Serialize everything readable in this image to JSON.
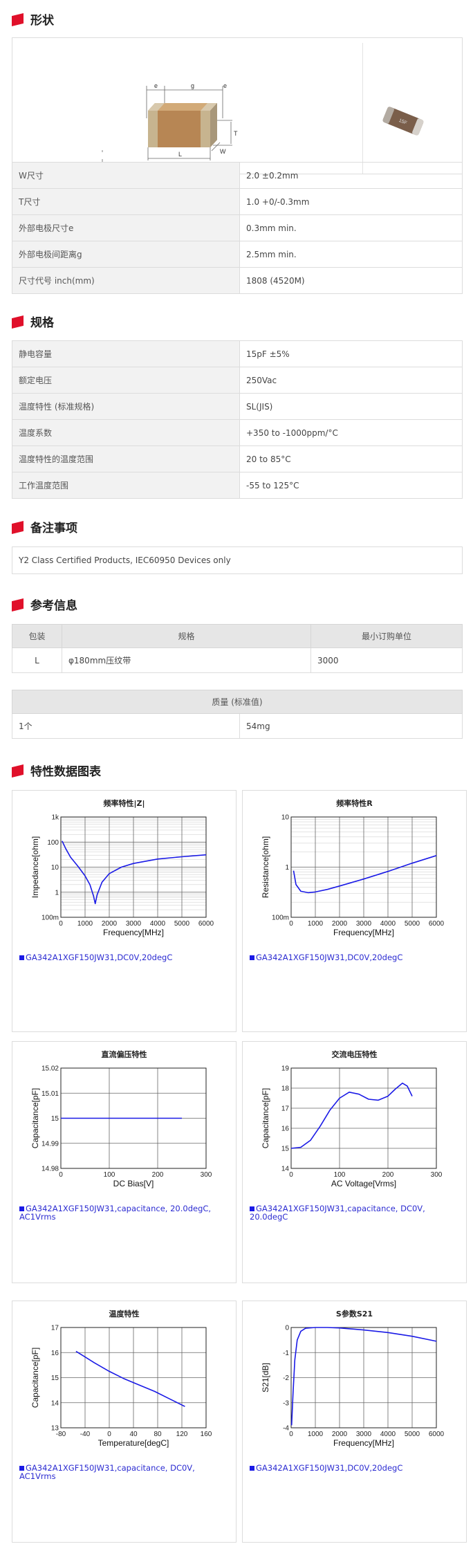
{
  "sections": {
    "shape": "形状",
    "spec": "规格",
    "notes": "备注事项",
    "ref": "参考信息",
    "charts": "特性数据图表"
  },
  "diagram": {
    "e1": "e",
    "g": "g",
    "e2": "e",
    "t": "T",
    "l": "L",
    "w": "W",
    "part_mark": "15F"
  },
  "shape_rows": [
    {
      "k": "W尺寸",
      "v": "2.0 ±0.2mm"
    },
    {
      "k": "T尺寸",
      "v": "1.0 +0/-0.3mm"
    },
    {
      "k": "外部电极尺寸e",
      "v": "0.3mm min."
    },
    {
      "k": "外部电极间距离g",
      "v": "2.5mm min."
    },
    {
      "k": "尺寸代号 inch(mm)",
      "v": "1808 (4520M)"
    }
  ],
  "spec_rows": [
    {
      "k": "静电容量",
      "v": "15pF ±5%"
    },
    {
      "k": "额定电压",
      "v": "250Vac"
    },
    {
      "k": "温度特性 (标准规格)",
      "v": "SL(JIS)"
    },
    {
      "k": "温度系数",
      "v": "+350 to -1000ppm/°C"
    },
    {
      "k": "温度特性的温度范围",
      "v": "20 to 85°C"
    },
    {
      "k": "工作温度范围",
      "v": "-55 to 125°C"
    }
  ],
  "notes_text": "Y2 Class Certified Products, IEC60950 Devices only",
  "ref_table": {
    "headers": [
      "包装",
      "规格",
      "最小订购单位"
    ],
    "row": [
      "L",
      "φ180mm压纹带",
      "3000"
    ]
  },
  "mass_table": {
    "header": "质量 (标准值)",
    "row": [
      "1个",
      "54mg"
    ]
  },
  "colors": {
    "accent": "#e0102a",
    "curve": "#1a1ae6",
    "legend": "#2b2bd1"
  },
  "chart_data": [
    {
      "type": "line",
      "title": "频率特性|Z|",
      "xlabel": "Frequency[MHz]",
      "ylabel": "Impedance[ohm]",
      "xlim": [
        0,
        6000
      ],
      "ylim": [
        0.1,
        1000
      ],
      "yscale": "log",
      "xticks": [
        "0",
        "1000",
        "2000",
        "3000",
        "4000",
        "5000",
        "6000"
      ],
      "yticks": [
        "100m",
        "1",
        "10",
        "100",
        "1k"
      ],
      "series": [
        {
          "name": "GA342A1XGF150JW31,DC0V,20degC",
          "x": [
            50,
            200,
            400,
            700,
            1000,
            1200,
            1350,
            1420,
            1500,
            1700,
            2000,
            2500,
            3000,
            4000,
            5000,
            6000
          ],
          "y": [
            110,
            55,
            25,
            11,
            4.5,
            2,
            0.7,
            0.35,
            0.8,
            2.5,
            5.5,
            10,
            14,
            21,
            26,
            31
          ]
        }
      ],
      "legend": "GA342A1XGF150JW31,DC0V,20degC"
    },
    {
      "type": "line",
      "title": "频率特性R",
      "xlabel": "Frequency[MHz]",
      "ylabel": "Resistance[ohm]",
      "xlim": [
        0,
        6000
      ],
      "ylim": [
        0.1,
        10
      ],
      "yscale": "log",
      "xticks": [
        "0",
        "1000",
        "2000",
        "3000",
        "4000",
        "5000",
        "6000"
      ],
      "yticks": [
        "100m",
        "1",
        "10"
      ],
      "series": [
        {
          "name": "GA342A1XGF150JW31,DC0V,20degC",
          "x": [
            100,
            200,
            400,
            700,
            1000,
            1500,
            2000,
            3000,
            4000,
            5000,
            6000
          ],
          "y": [
            0.85,
            0.45,
            0.33,
            0.31,
            0.32,
            0.36,
            0.42,
            0.58,
            0.82,
            1.2,
            1.7
          ]
        }
      ],
      "legend": "GA342A1XGF150JW31,DC0V,20degC"
    },
    {
      "type": "line",
      "title": "直流偏压特性",
      "xlabel": "DC Bias[V]",
      "ylabel": "Capacitance[pF]",
      "xlim": [
        0,
        300
      ],
      "ylim": [
        14.98,
        15.02
      ],
      "xticks": [
        "0",
        "100",
        "200",
        "300"
      ],
      "yticks": [
        "14.98",
        "14.99",
        "15",
        "15.01",
        "15.02"
      ],
      "series": [
        {
          "name": "GA342A1XGF150JW31,capacitance, 20.0degC, AC1Vrms",
          "x": [
            0,
            250
          ],
          "y": [
            15,
            15
          ]
        }
      ],
      "legend": "GA342A1XGF150JW31,capacitance, 20.0degC, AC1Vrms"
    },
    {
      "type": "line",
      "title": "交流电压特性",
      "xlabel": "AC Voltage[Vrms]",
      "ylabel": "Capacitance[pF]",
      "xlim": [
        0,
        300
      ],
      "ylim": [
        14,
        19
      ],
      "xticks": [
        "0",
        "100",
        "200",
        "300"
      ],
      "yticks": [
        "14",
        "15",
        "16",
        "17",
        "18",
        "19"
      ],
      "series": [
        {
          "name": "GA342A1XGF150JW31,capacitance, DC0V, 20.0degC",
          "x": [
            0,
            20,
            40,
            60,
            80,
            100,
            120,
            140,
            160,
            180,
            200,
            215,
            230,
            240,
            250
          ],
          "y": [
            15.0,
            15.05,
            15.4,
            16.1,
            16.9,
            17.5,
            17.8,
            17.7,
            17.45,
            17.4,
            17.6,
            17.95,
            18.25,
            18.1,
            17.6
          ]
        }
      ],
      "legend": "GA342A1XGF150JW31,capacitance, DC0V, 20.0degC"
    },
    {
      "type": "line",
      "title": "温度特性",
      "xlabel": "Temperature[degC]",
      "ylabel": "Capacitance[pF]",
      "xlim": [
        -80,
        160
      ],
      "ylim": [
        13,
        17
      ],
      "xticks": [
        "-80",
        "-40",
        "0",
        "40",
        "80",
        "120",
        "160"
      ],
      "yticks": [
        "13",
        "14",
        "15",
        "16",
        "17"
      ],
      "series": [
        {
          "name": "GA342A1XGF150JW31,capacitance, DC0V, AC1Vrms",
          "x": [
            -55,
            -25,
            0,
            25,
            50,
            75,
            100,
            125
          ],
          "y": [
            16.05,
            15.6,
            15.25,
            14.95,
            14.7,
            14.45,
            14.15,
            13.85
          ]
        }
      ],
      "legend": "GA342A1XGF150JW31,capacitance, DC0V, AC1Vrms"
    },
    {
      "type": "line",
      "title": "S参数S21",
      "xlabel": "Frequency[MHz]",
      "ylabel": "S21[dB]",
      "xlim": [
        0,
        6000
      ],
      "ylim": [
        -4,
        0
      ],
      "xticks": [
        "0",
        "1000",
        "2000",
        "3000",
        "4000",
        "5000",
        "6000"
      ],
      "yticks": [
        "-4",
        "-3",
        "-2",
        "-1",
        "0"
      ],
      "series": [
        {
          "name": "GA342A1XGF150JW31,DC0V,20degC",
          "x": [
            20,
            80,
            150,
            250,
            400,
            600,
            1000,
            1500,
            2000,
            3000,
            4000,
            5000,
            6000
          ],
          "y": [
            -3.9,
            -2.6,
            -1.3,
            -0.5,
            -0.15,
            -0.03,
            0,
            0,
            -0.02,
            -0.1,
            -0.2,
            -0.35,
            -0.55
          ]
        }
      ],
      "legend": "GA342A1XGF150JW31,DC0V,20degC"
    }
  ]
}
